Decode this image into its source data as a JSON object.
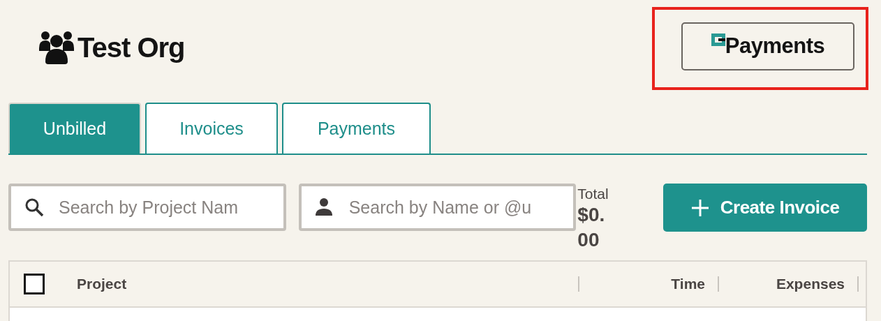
{
  "header": {
    "org_name": "Test Org",
    "payments_button": {
      "label": "Payments",
      "highlighted": true
    }
  },
  "tabs": [
    {
      "label": "Unbilled",
      "selected": true
    },
    {
      "label": "Invoices",
      "selected": false
    },
    {
      "label": "Payments",
      "selected": false
    }
  ],
  "filters": [
    {
      "kind": "project",
      "placeholder": "Search by Project Nam"
    },
    {
      "kind": "person",
      "placeholder": "Search by Name or @u"
    }
  ],
  "total": {
    "label": "Total",
    "value": "$0.00"
  },
  "create_button": {
    "label": "Create Invoice"
  },
  "table": {
    "select_all_checked": false,
    "columns": [
      {
        "label": "Project"
      },
      {
        "label": "Time"
      },
      {
        "label": "Expenses"
      }
    ]
  }
}
